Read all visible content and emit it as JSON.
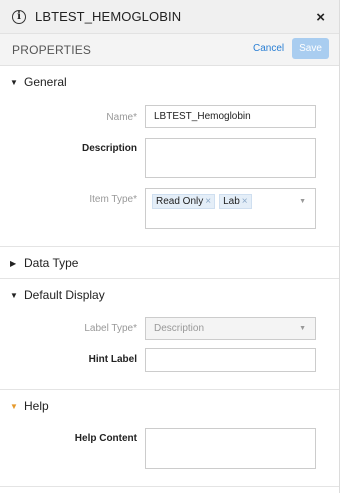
{
  "header": {
    "title": "LBTEST_HEMOGLOBIN",
    "close_glyph": "×",
    "info_glyph": "i"
  },
  "toolbar": {
    "title": "PROPERTIES",
    "cancel_label": "Cancel",
    "save_label": "Save"
  },
  "sections": {
    "general": {
      "label": "General",
      "name_label": "Name*",
      "name_value": "LBTEST_Hemoglobin",
      "description_label": "Description",
      "description_value": "",
      "item_type_label": "Item Type*",
      "item_type_tags": [
        "Read Only",
        "Lab"
      ]
    },
    "data_type": {
      "label": "Data Type"
    },
    "default_display": {
      "label": "Default Display",
      "label_type_label": "Label Type*",
      "label_type_value": "Description",
      "hint_label_label": "Hint Label",
      "hint_label_value": ""
    },
    "help": {
      "label": "Help",
      "help_content_label": "Help Content",
      "help_content_value": ""
    }
  },
  "icons": {
    "expanded_caret": "▼",
    "collapsed_caret": "▶",
    "tag_remove": "×",
    "dropdown_arrow": "▼"
  },
  "colors": {
    "accent": "#2a7fd4",
    "save_disabled": "#a9cdf0",
    "help_caret": "#e69a2b",
    "tag_bg": "#e4eef8"
  }
}
